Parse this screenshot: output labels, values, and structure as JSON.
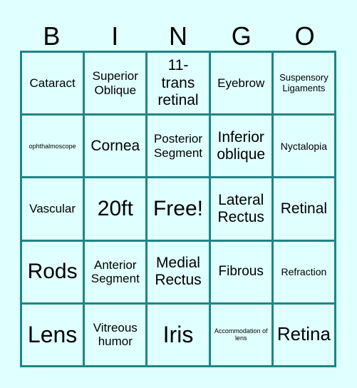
{
  "colors": {
    "background": "#E0FFFF",
    "grid_line": "#1E8585",
    "text": "#000000"
  },
  "header": [
    "B",
    "I",
    "N",
    "G",
    "O"
  ],
  "cells": [
    [
      "Cataract",
      "Superior Oblique",
      "11- trans retinal",
      "Eyebrow",
      "Suspensory Ligaments"
    ],
    [
      "ophthalmoscope",
      "Cornea",
      "Posterior Segment",
      "Inferior oblique",
      "Nyctalopia"
    ],
    [
      "Vascular",
      "20ft",
      "Free!",
      "Lateral Rectus",
      "Retinal"
    ],
    [
      "Rods",
      "Anterior Segment",
      "Medial Rectus",
      "Fibrous",
      "Refraction"
    ],
    [
      "Lens",
      "Vitreous humor",
      "Iris",
      "Accommodation of lens",
      "Retina"
    ]
  ]
}
